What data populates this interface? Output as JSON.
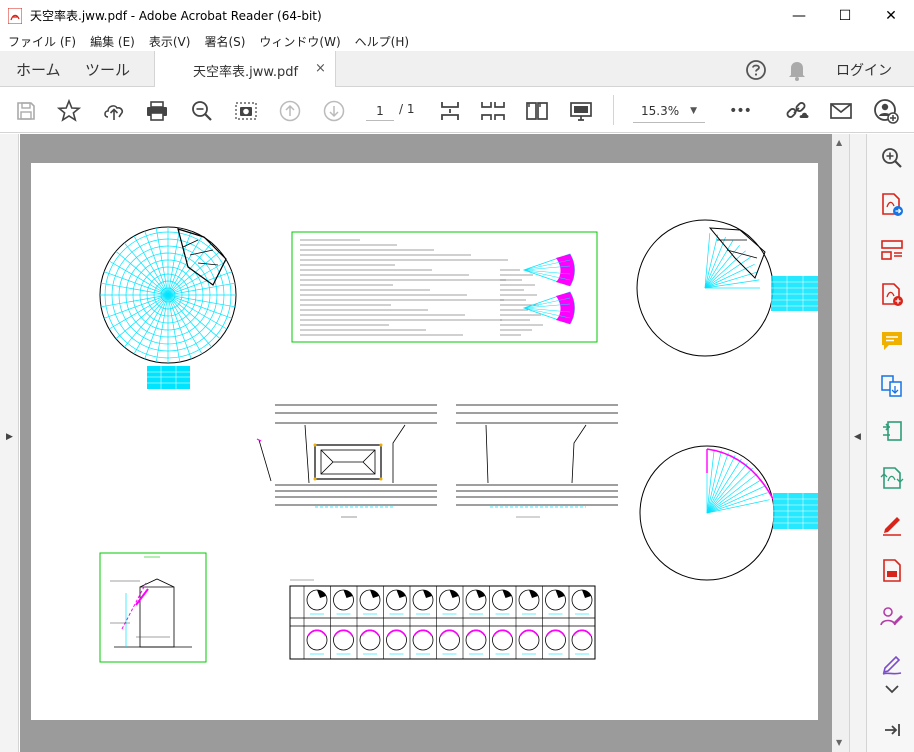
{
  "window": {
    "title": "天空率表.jww.pdf - Adobe Acrobat Reader (64-bit)",
    "minimize": "—",
    "maximize": "☐",
    "close": "✕"
  },
  "menu": [
    "ファイル (F)",
    "編集 (E)",
    "表示(V)",
    "署名(S)",
    "ウィンドウ(W)",
    "ヘルプ(H)"
  ],
  "tabs": {
    "home": "ホーム",
    "tools": "ツール",
    "document": "天空率表.jww.pdf",
    "close": "×"
  },
  "account": {
    "login": "ログイン"
  },
  "toolbar": {
    "page_current": "1",
    "page_total": "/ 1",
    "zoom": "15.3%",
    "more": "•••"
  },
  "colors": {
    "acrobat_red": "#d7251b",
    "grid_cyan": "#00e5ff",
    "magenta": "#ff00ff",
    "green_frame": "#00c800",
    "viewport_gray": "#9b9b9b"
  },
  "icons": {
    "toolbar": [
      "save-icon",
      "star-icon",
      "cloud-upload-icon",
      "print-icon",
      "zoom-search-icon",
      "snapshot-icon",
      "prev-page-icon",
      "next-page-icon",
      "fit-page-icon",
      "fit-width-icon",
      "two-page-icon",
      "read-mode-icon",
      "share-link-icon",
      "mail-icon",
      "add-user-icon"
    ],
    "right_panel": [
      "zoom-in-icon",
      "export-pdf-icon",
      "organize-pages-icon",
      "create-pdf-icon",
      "comment-icon",
      "combine-files-icon",
      "compress-icon",
      "convert-icon",
      "fill-sign-icon",
      "scan-icon",
      "request-signature-icon",
      "sign-icon",
      "expand-icon",
      "collapse-panel-icon"
    ]
  }
}
